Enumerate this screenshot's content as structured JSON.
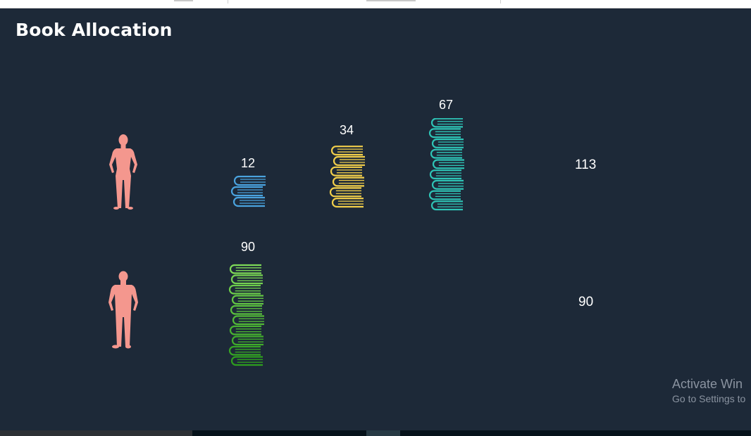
{
  "title": "Book Allocation",
  "rows": [
    {
      "person": "female",
      "groups": [
        {
          "count": "12",
          "books": 3,
          "color": "#4aa3df"
        },
        {
          "count": "34",
          "books": 6,
          "color": "#f2cf4a"
        },
        {
          "count": "67",
          "books": 9,
          "color": "#2ec4b6"
        }
      ],
      "total": "113"
    },
    {
      "person": "male",
      "groups": [
        {
          "count": "90",
          "books": 10,
          "color": "#7ed957"
        }
      ],
      "total": "90"
    }
  ],
  "colors": {
    "background": "#1d2938",
    "person": "#f4978e",
    "green_dark": "#2e9e1e",
    "text": "#ffffff"
  },
  "watermark": {
    "line1": "Activate Win",
    "line2": "Go to Settings to"
  }
}
